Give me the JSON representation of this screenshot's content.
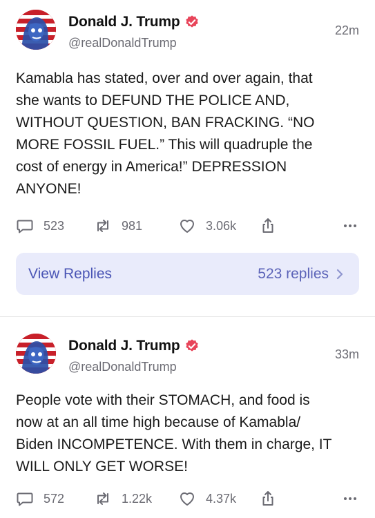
{
  "posts": [
    {
      "author": "Donald J. Trump",
      "handle": "@realDonaldTrump",
      "time": "22m",
      "text": "Kamabla has stated, over and over again, that\nshe wants to DEFUND THE POLICE AND,\nWITHOUT QUESTION, BAN FRACKING. “NO\nMORE FOSSIL FUEL.” This will quadruple the\ncost of energy in America!” DEPRESSION\nANYONE!",
      "replies": "523",
      "retruths": "981",
      "likes": "3.06k",
      "view_replies_label": "View Replies",
      "replies_count_label": "523 replies"
    },
    {
      "author": "Donald J. Trump",
      "handle": "@realDonaldTrump",
      "time": "33m",
      "text": "People vote with their STOMACH, and food is\nnow at an all time high because of Kamabla/\nBiden INCOMPETENCE. With them in charge, IT\nWILL ONLY GET WORSE!",
      "replies": "572",
      "retruths": "1.22k",
      "likes": "4.37k"
    }
  ],
  "colors": {
    "verified": "#e8455a",
    "accent_text": "#4a55b5",
    "replies_bg": "#e9ebfb",
    "muted": "#6b6b73"
  },
  "icons": [
    "verified-badge-icon",
    "reply-bubble-icon",
    "retruth-icon",
    "heart-icon",
    "share-icon",
    "more-dots-icon",
    "chevron-right-icon"
  ]
}
